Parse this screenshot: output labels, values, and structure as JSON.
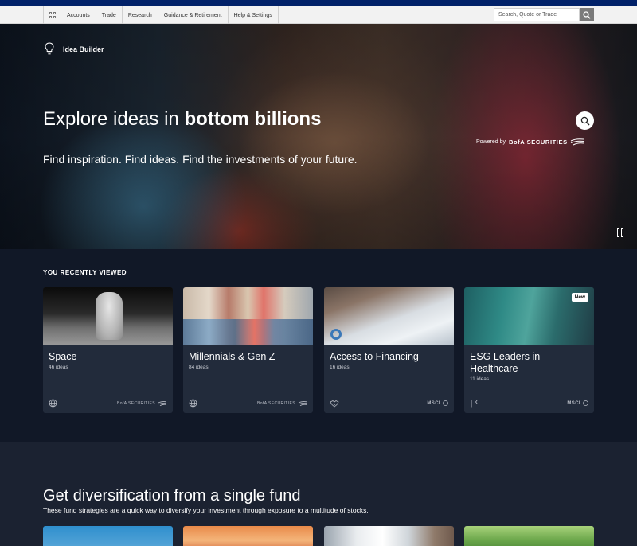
{
  "nav": {
    "items": [
      "Accounts",
      "Trade",
      "Research",
      "Guidance & Retirement",
      "Help & Settings"
    ],
    "search_placeholder": "Search, Quote or Trade"
  },
  "hero": {
    "section_label": "Idea Builder",
    "title_prefix": "Explore ideas in",
    "title_highlight": "bottom billions",
    "powered_by": "Powered by",
    "powered_brand": "BofA SECURITIES",
    "subtitle": "Find inspiration. Find ideas. Find the investments of your future."
  },
  "recent": {
    "heading": "YOU RECENTLY VIEWED",
    "cards": [
      {
        "title": "Space",
        "count": "46 ideas",
        "provider": "BofA SECURITIES",
        "icon": "globe-icon"
      },
      {
        "title": "Millennials & Gen Z",
        "count": "84 ideas",
        "provider": "BofA SECURITIES",
        "icon": "globe-icon"
      },
      {
        "title": "Access to Financing",
        "count": "16 ideas",
        "provider": "MSCI",
        "icon": "handshake-icon"
      },
      {
        "title": "ESG Leaders in Healthcare",
        "count": "11 ideas",
        "provider": "MSCI",
        "icon": "flag-icon",
        "badge": "New"
      }
    ]
  },
  "diversify": {
    "title": "Get diversification from a single fund",
    "subtitle": "These fund strategies are a quick way to diversify your investment through exposure to a multitude of stocks."
  },
  "colors": {
    "brand_navy": "#012169",
    "card_bg": "#222b3b",
    "section_bg": "#111827"
  }
}
